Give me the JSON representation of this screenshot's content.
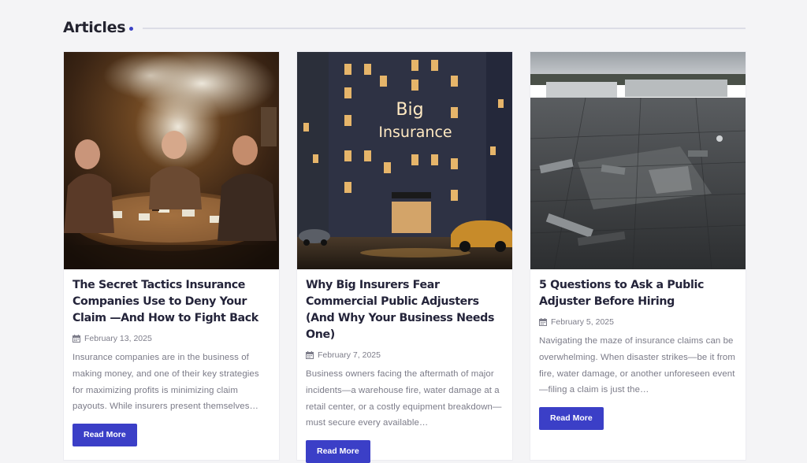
{
  "section": {
    "title": "Articles"
  },
  "colors": {
    "accent": "#3b3fc7",
    "text": "#24243a",
    "muted": "#7b7b88"
  },
  "articles": [
    {
      "image_alt": "Three men around a smoky card table",
      "title": "The Secret Tactics Insurance Companies Use to Deny Your Claim —And How to Fight Back",
      "date": "February 13, 2025",
      "date_icon": "calendar-icon",
      "excerpt": "Insurance companies are in the business of making money, and one of their key strategies for maximizing profits is minimizing claim payouts. While insurers present themselves…",
      "button": "Read More"
    },
    {
      "image_alt": "Big Insurance skyscraper at night with vintage cars",
      "image_text": "Big Insurance",
      "title": "Why Big Insurers Fear Commercial Public Adjusters (And Why Your Business Needs One)",
      "date": "February 7, 2025",
      "date_icon": "calendar-icon",
      "excerpt": "Business owners facing the aftermath of major incidents—a warehouse fire, water damage at a retail center, or a costly equipment breakdown—must secure every available…",
      "button": "Read More"
    },
    {
      "image_alt": "Damaged commercial flat roof",
      "title": "5 Questions to Ask a Public Adjuster Before Hiring",
      "date": "February 5, 2025",
      "date_icon": "calendar-icon",
      "excerpt": "Navigating the maze of insurance claims can be overwhelming. When disaster strikes—be it from fire, water damage, or another unforeseen event—filing a claim is just the…",
      "button": "Read More"
    }
  ]
}
